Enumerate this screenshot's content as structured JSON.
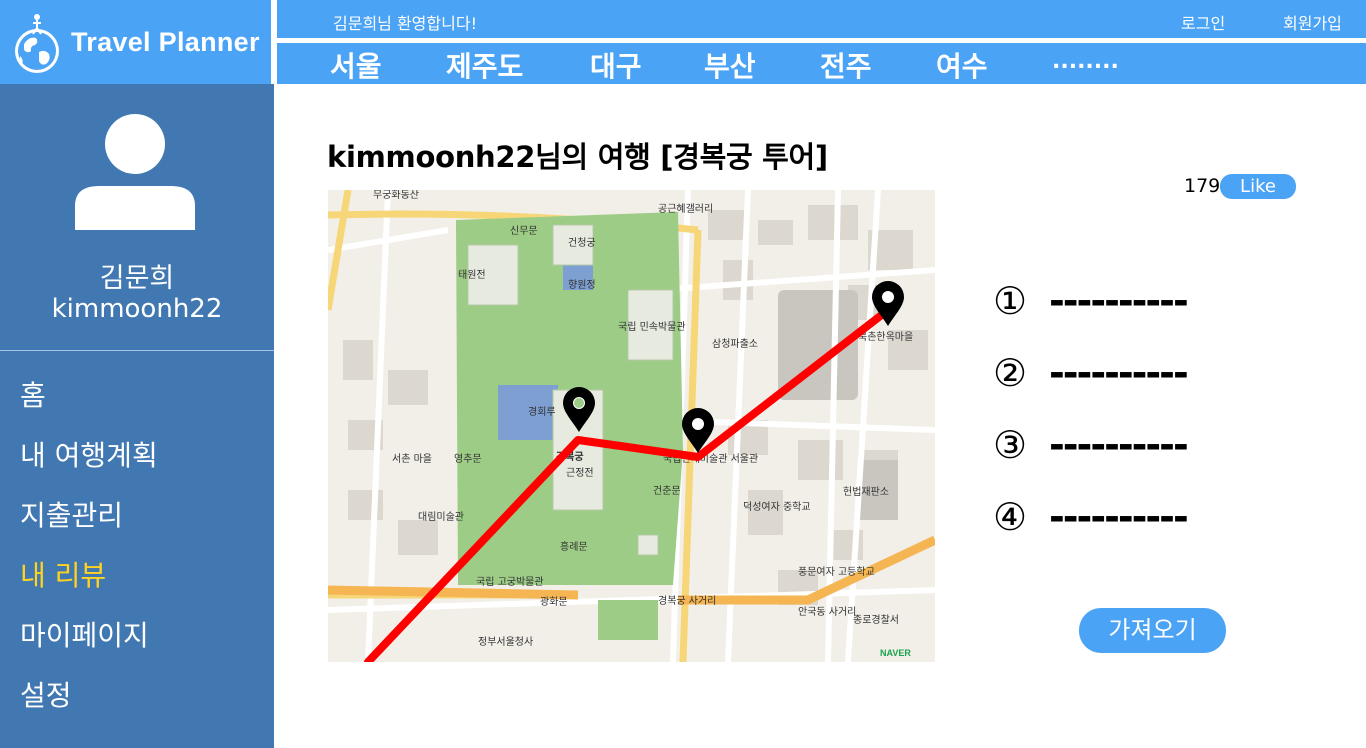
{
  "header": {
    "logo_text": "Travel Planner",
    "welcome": "김문희님 환영합니다!",
    "login": "로그인",
    "signup": "회원가입",
    "nav_items": [
      "서울",
      "제주도",
      "대구",
      "부산",
      "전주",
      "여수",
      "........"
    ]
  },
  "sidebar": {
    "user_name": "김문희",
    "user_id": "kimmoonh22",
    "menu": [
      {
        "label": "홈"
      },
      {
        "label": "내 여행계획"
      },
      {
        "label": "지출관리"
      },
      {
        "label": "내 리뷰",
        "active": true
      },
      {
        "label": "마이페이지"
      },
      {
        "label": "설정"
      }
    ]
  },
  "main": {
    "title": "kimmoonh22님의 여행 [경복궁 투어]",
    "likes": "179",
    "like_label": "Like",
    "stops": [
      "①",
      "②",
      "③",
      "④"
    ],
    "stop_placeholder": "----------",
    "import_button": "가져오기"
  },
  "map": {
    "labels": {
      "gyeongbokgung": "경복궁",
      "geunjeongjeon": "근정전",
      "hyangwonjeong": "향원정",
      "gyeonghoeru": "경회루",
      "folk_museum": "국립 민속박물관",
      "palace_museum": "국립 고궁박물관",
      "mmca": "국립현대미술관 서울관",
      "bukchon": "북촌한옥마을",
      "seochon": "서촌 마을",
      "gwanghwamun": "광화문",
      "sinmumun": "신무문",
      "geoncheongung": "건청궁",
      "yeongchumun": "영추문",
      "geonchunmun": "건춘문",
      "heungryemun": "흥례문",
      "taewonjeon": "태원전",
      "samcheong": "삼청파출소",
      "gongsae": "공근혜갤러리",
      "sejong_govt": "정부서울청사",
      "jongno_police": "종로경찰서",
      "hyeonbeop": "헌법재판소",
      "deokseong": "덕성여자 중학교",
      "pungmun": "풍문여자 고등학교",
      "daelim": "대림미술관",
      "gyeongbokgung_station": "경복궁 사거리",
      "anguk": "안국동 사거리",
      "naver": "NAVER"
    },
    "route_color": "#ff0000",
    "park_color": "#9ccc85"
  },
  "colors": {
    "header_blue": "#4aa3f5",
    "sidebar_blue": "#4178b1",
    "active_menu": "#ffd31f"
  },
  "icons": {
    "logo": "globe-traveler-icon",
    "avatar": "user-avatar-icon",
    "map_pin": "map-pin-icon"
  }
}
